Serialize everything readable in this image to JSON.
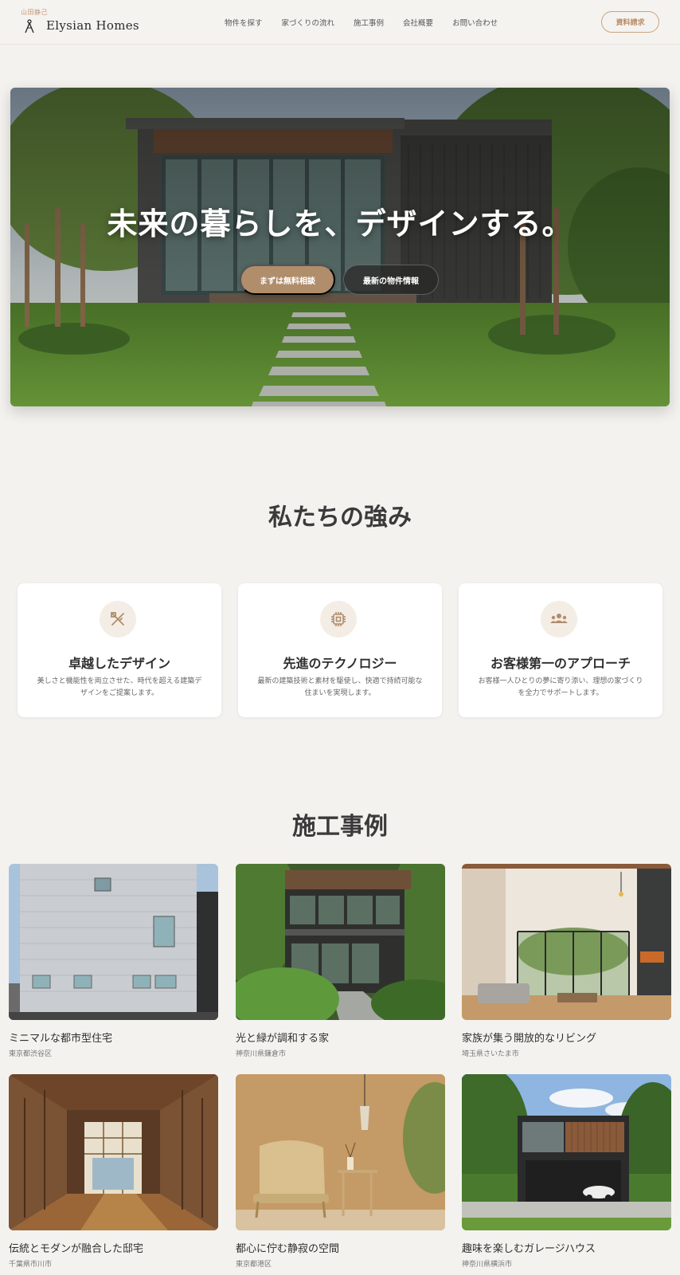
{
  "header": {
    "owner": "山田静己",
    "brand": "Elysian Homes",
    "nav": [
      "物件を探す",
      "家づくりの流れ",
      "施工事例",
      "会社概要",
      "お問い合わせ"
    ],
    "cta": "資料請求"
  },
  "hero": {
    "title": "未来の暮らしを、デザインする。",
    "primary_button": "まずは無料相談",
    "secondary_button": "最新の物件情報"
  },
  "strengths": {
    "title": "私たちの強み",
    "items": [
      {
        "icon": "design-tools-icon",
        "title": "卓越したデザイン",
        "desc": "美しさと機能性を両立させた、時代を超える建築デザインをご提案します。"
      },
      {
        "icon": "chip-icon",
        "title": "先進のテクノロジー",
        "desc": "最新の建築技術と素材を駆使し、快適で持続可能な住まいを実現します。"
      },
      {
        "icon": "people-icon",
        "title": "お客様第一のアプローチ",
        "desc": "お客様一人ひとりの夢に寄り添い、理想の家づくりを全力でサポートします。"
      }
    ]
  },
  "works": {
    "title": "施工事例",
    "items": [
      {
        "title": "ミニマルな都市型住宅",
        "location": "東京都渋谷区"
      },
      {
        "title": "光と緑が調和する家",
        "location": "神奈川県鎌倉市"
      },
      {
        "title": "家族が集う開放的なリビング",
        "location": "埼玉県さいたま市"
      },
      {
        "title": "伝統とモダンが融合した邸宅",
        "location": "千葉県市川市"
      },
      {
        "title": "都心に佇む静寂の空間",
        "location": "東京都港区"
      },
      {
        "title": "趣味を楽しむガレージハウス",
        "location": "神奈川県横浜市"
      }
    ]
  },
  "colors": {
    "accent": "#b08d6b",
    "background": "#f4f2ef"
  }
}
